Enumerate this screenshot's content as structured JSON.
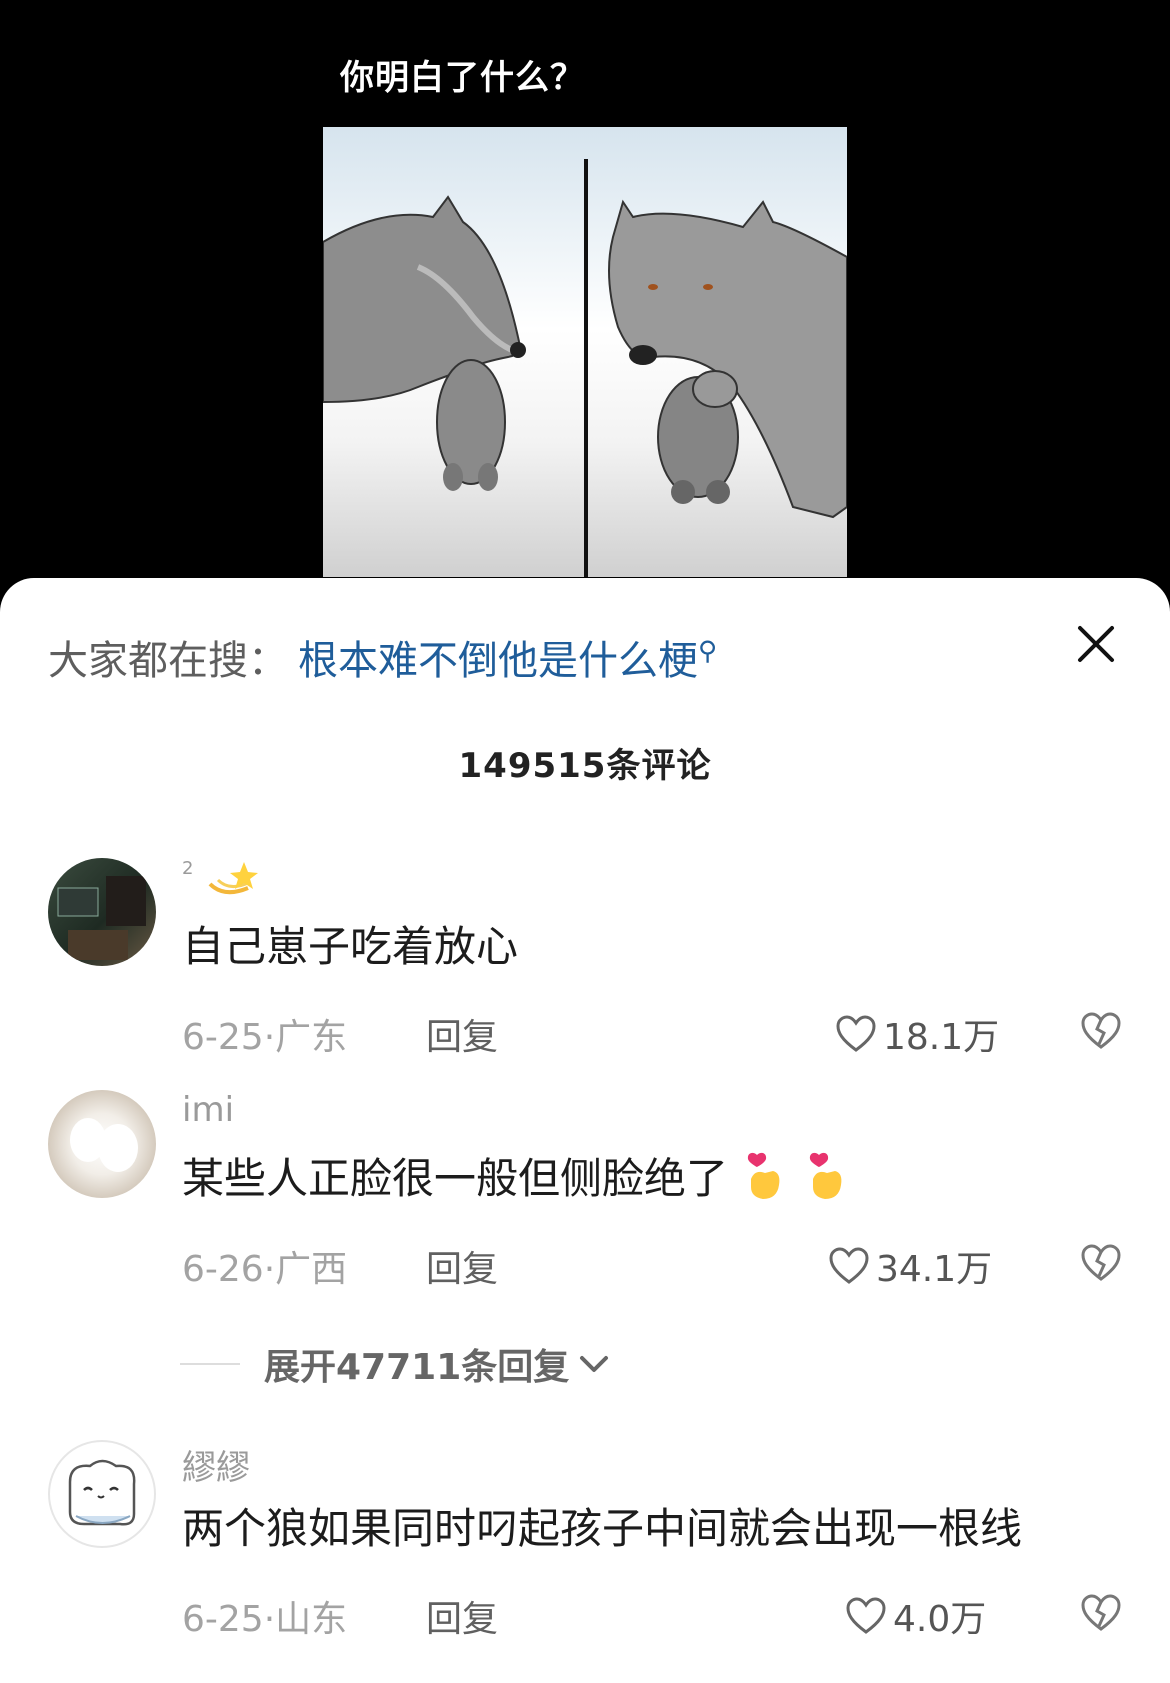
{
  "video": {
    "caption": "你明白了什么？"
  },
  "sheet": {
    "search_label": "大家都在搜：",
    "search_query": "根本难不倒他是什么梗",
    "comment_count": "149515条评论",
    "comments": [
      {
        "user": "2",
        "text": "自己崽子吃着放心",
        "date": "6-25·广东",
        "reply": "回复",
        "likes": "18.1万"
      },
      {
        "user": "imi",
        "text": "某些人正脸很一般但侧脸绝了",
        "date": "6-26·广西",
        "reply": "回复",
        "likes": "34.1万"
      },
      {
        "user": "繆繆",
        "text": "两个狼如果同时叼起孩子中间就会出现一根线",
        "date": "6-25·山东",
        "reply": "回复",
        "likes": "4.0万"
      }
    ],
    "expand_label": "展开47711条回复"
  },
  "icons": [
    "close-icon",
    "search-icon",
    "heart-icon",
    "broken-heart-icon",
    "chevron-down-icon",
    "dizzy-star-icon",
    "finger-heart-icon"
  ]
}
